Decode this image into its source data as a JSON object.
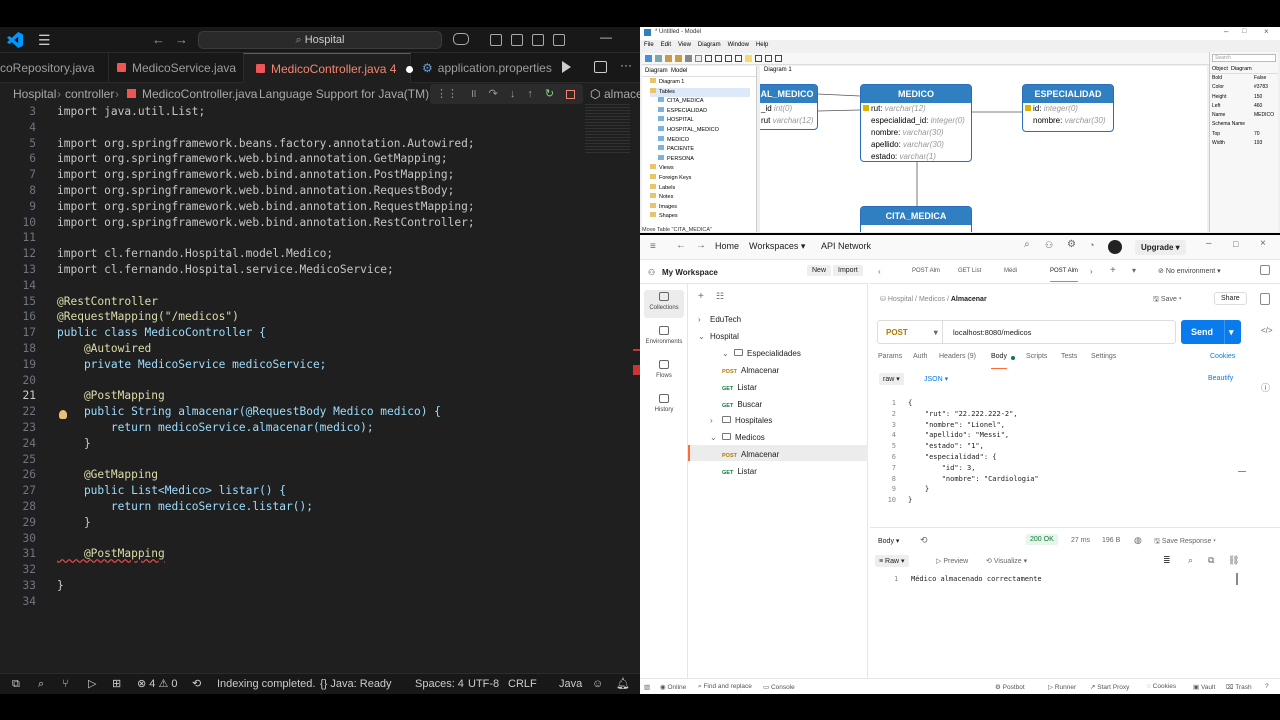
{
  "vscode": {
    "search": "Hospital",
    "tabs": [
      "coRepository.java",
      "MedicoService.java",
      "MedicoController.java 4",
      "application.properties"
    ],
    "breadcrumb": [
      "Hospital",
      "controller",
      "MedicoController.java",
      "Language Support for Java(TM) by I"
    ],
    "breadcrumb_right": "almacen",
    "lines": [
      {
        "n": "3",
        "t": "import java.util.List;"
      },
      {
        "n": "4",
        "t": ""
      },
      {
        "n": "5",
        "t": "import org.springframework.beans.factory.annotation.Autowired;"
      },
      {
        "n": "6",
        "t": "import org.springframework.web.bind.annotation.GetMapping;"
      },
      {
        "n": "7",
        "t": "import org.springframework.web.bind.annotation.PostMapping;"
      },
      {
        "n": "8",
        "t": "import org.springframework.web.bind.annotation.RequestBody;"
      },
      {
        "n": "9",
        "t": "import org.springframework.web.bind.annotation.RequestMapping;"
      },
      {
        "n": "10",
        "t": "import org.springframework.web.bind.annotation.RestController;"
      },
      {
        "n": "11",
        "t": ""
      },
      {
        "n": "12",
        "t": "import cl.fernando.Hospital.model.Medico;"
      },
      {
        "n": "13",
        "t": "import cl.fernando.Hospital.service.MedicoService;"
      },
      {
        "n": "14",
        "t": ""
      },
      {
        "n": "15",
        "t": "@RestController"
      },
      {
        "n": "16",
        "t": "@RequestMapping(\"/medicos\")"
      },
      {
        "n": "17",
        "t": "public class MedicoController {"
      },
      {
        "n": "18",
        "t": "    @Autowired"
      },
      {
        "n": "19",
        "t": "    private MedicoService medicoService;"
      },
      {
        "n": "20",
        "t": ""
      },
      {
        "n": "21",
        "t": "    @PostMapping"
      },
      {
        "n": "22",
        "t": "    public String almacenar(@RequestBody Medico medico) {"
      },
      {
        "n": "23",
        "t": "        return medicoService.almacenar(medico);"
      },
      {
        "n": "24",
        "t": "    }"
      },
      {
        "n": "25",
        "t": ""
      },
      {
        "n": "26",
        "t": "    @GetMapping"
      },
      {
        "n": "27",
        "t": "    public List<Medico> listar() {"
      },
      {
        "n": "28",
        "t": "        return medicoService.listar();"
      },
      {
        "n": "29",
        "t": "    }"
      },
      {
        "n": "30",
        "t": ""
      },
      {
        "n": "31",
        "t": "    @PostMapping"
      },
      {
        "n": "32",
        "t": ""
      },
      {
        "n": "33",
        "t": "}"
      },
      {
        "n": "34",
        "t": ""
      }
    ],
    "status": {
      "problems": "4",
      "warnings": "0",
      "indexing": "Indexing completed.",
      "java": "Java: Ready",
      "spaces": "Spaces: 4",
      "encoding": "UTF-8",
      "eol": "CRLF",
      "lang": "Java"
    }
  },
  "modeler": {
    "title": "* Untitled - Model",
    "menu": [
      "File",
      "Edit",
      "View",
      "Diagram",
      "Window",
      "Help"
    ],
    "left_tabs": [
      "Diagram",
      "Model"
    ],
    "diagram_tab": "Diagram 1",
    "tree": [
      "Diagram 1",
      "Tables",
      "CITA_MEDICA",
      "ESPECIALIDAD",
      "HOSPITAL",
      "HOSPITAL_MEDICO",
      "MEDICO",
      "PACIENTE",
      "PERSONA",
      "Views",
      "Foreign Keys",
      "Labels",
      "Notes",
      "Images",
      "Shapes"
    ],
    "bottom_hint": "Move Table \"CITA_MEDICA\"",
    "entities": {
      "left": {
        "name": "AL_MEDICO",
        "fields": [
          {
            "n": "_id",
            "t": "int(0)"
          },
          {
            "n": "rut",
            "t": "varchar(12)"
          }
        ]
      },
      "medico": {
        "name": "MEDICO",
        "fields": [
          {
            "n": "rut",
            "t": "varchar(12)"
          },
          {
            "n": "especialidad_id",
            "t": "integer(0)"
          },
          {
            "n": "nombre",
            "t": "varchar(30)"
          },
          {
            "n": "apellido",
            "t": "varchar(30)"
          },
          {
            "n": "estado",
            "t": "varchar(1)"
          }
        ]
      },
      "especialidad": {
        "name": "ESPECIALIDAD",
        "fields": [
          {
            "n": "id",
            "t": "integer(0)"
          },
          {
            "n": "nombre",
            "t": "varchar(30)"
          }
        ]
      },
      "cita": {
        "name": "CITA_MEDICA"
      }
    },
    "search": "Search",
    "props_tabs": [
      "Object",
      "Diagram"
    ],
    "props": [
      [
        "Bold",
        "False"
      ],
      [
        "Color",
        "#3783"
      ],
      [
        "Height",
        "150"
      ],
      [
        "Left",
        "460"
      ],
      [
        "Name",
        "MEDICO"
      ],
      [
        "Schema Name",
        ""
      ],
      [
        "Top",
        "70"
      ],
      [
        "Width",
        "193"
      ]
    ]
  },
  "postman": {
    "nav": [
      "Home",
      "Workspaces",
      "API Network"
    ],
    "upgrade": "Upgrade",
    "workspace": "My Workspace",
    "new": "New",
    "import": "Import",
    "side": [
      "Collections",
      "Environments",
      "Flows",
      "History"
    ],
    "req_tabs": [
      "POST Alm",
      "GET List",
      "Médi",
      "POST Alm"
    ],
    "env": "No environment",
    "tree": [
      {
        "label": "EduTech",
        "method": ""
      },
      {
        "label": "Hospital",
        "method": ""
      },
      {
        "label": "Especialidades",
        "method": ""
      },
      {
        "label": "Almacenar",
        "method": "POST"
      },
      {
        "label": "Listar",
        "method": "GET"
      },
      {
        "label": "Buscar",
        "method": "GET"
      },
      {
        "label": "Hospitales",
        "method": ""
      },
      {
        "label": "Medicos",
        "method": ""
      },
      {
        "label": "Almacenar",
        "method": "POST"
      },
      {
        "label": "Listar",
        "method": "GET"
      }
    ],
    "crumb": [
      "Hospital",
      "Medicos",
      "Almacenar"
    ],
    "save": "Save",
    "share": "Share",
    "method": "POST",
    "url": "localhost:8080/medicos",
    "send": "Send",
    "req_subtabs": [
      "Params",
      "Auth",
      "Headers (9)",
      "Body",
      "Scripts",
      "Tests",
      "Settings"
    ],
    "cookies": "Cookies",
    "raw": "raw",
    "json": "JSON",
    "beautify": "Beautify",
    "body": [
      {
        "n": "1",
        "t": "{"
      },
      {
        "n": "2",
        "t": "    \"rut\": \"22.222.222-2\","
      },
      {
        "n": "3",
        "t": "    \"nombre\": \"Lionel\","
      },
      {
        "n": "4",
        "t": "    \"apellido\": \"Messi\","
      },
      {
        "n": "5",
        "t": "    \"estado\": \"1\","
      },
      {
        "n": "6",
        "t": "    \"especialidad\": {"
      },
      {
        "n": "7",
        "t": "        \"id\": 3,"
      },
      {
        "n": "8",
        "t": "        \"nombre\": \"Cardiologia\""
      },
      {
        "n": "9",
        "t": "    }"
      },
      {
        "n": "10",
        "t": "}"
      }
    ],
    "resp_label": "Body",
    "status": "200 OK",
    "time": "27 ms",
    "size": "196 B",
    "save_response": "Save Response",
    "resp_views": [
      "Raw",
      "Preview",
      "Visualize"
    ],
    "resp_line": "Médico almacenado correctamente",
    "footer": [
      "Online",
      "Find and replace",
      "Console",
      "Postbot",
      "Runner",
      "Start Proxy",
      "Cookies",
      "Vault",
      "Trash"
    ]
  }
}
